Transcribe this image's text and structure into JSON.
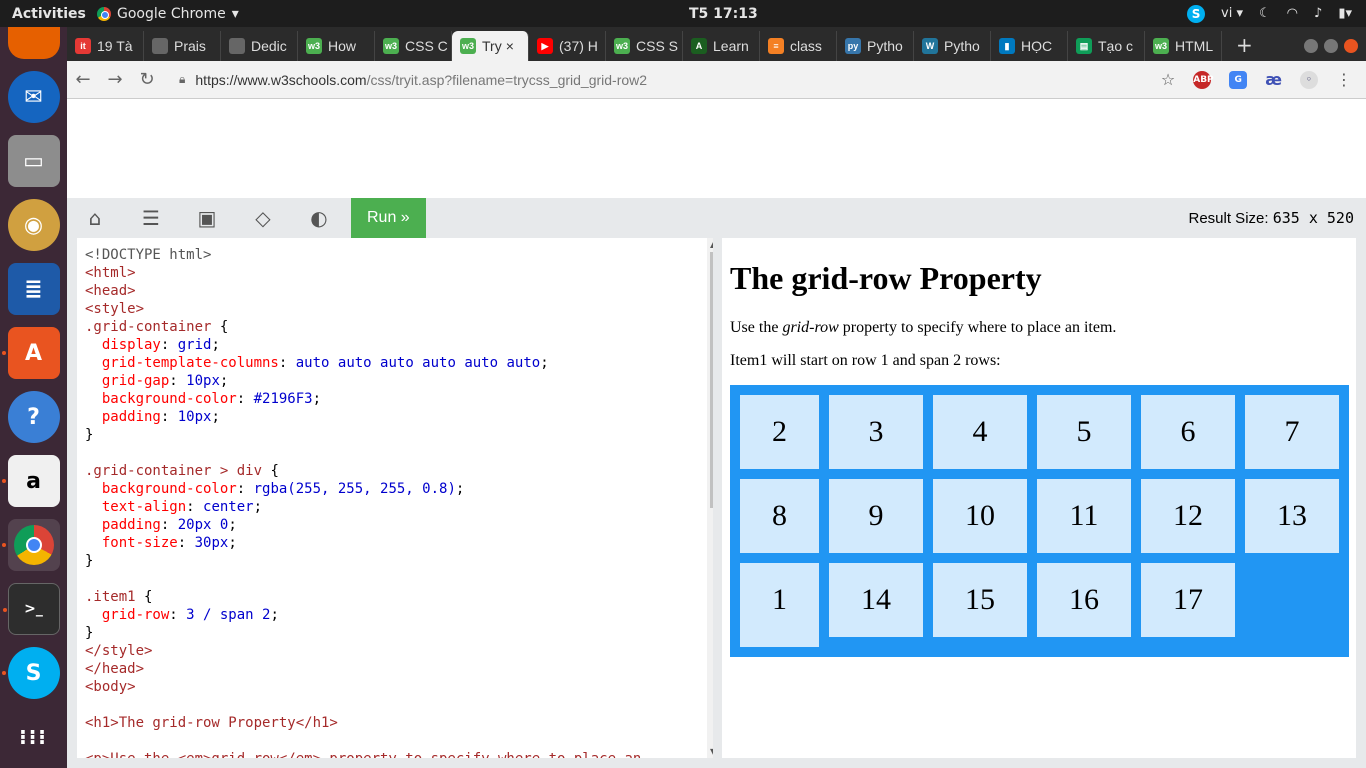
{
  "system": {
    "activities": "Activities",
    "app_name": "Google Chrome",
    "clock": "T5 17:13",
    "lang": "vi"
  },
  "tabs": [
    {
      "title": "19 Tà",
      "color": "#e53935",
      "icon_text": "it"
    },
    {
      "title": "Prais",
      "color": "#666666",
      "icon_text": ""
    },
    {
      "title": "Dedic",
      "color": "#666666",
      "icon_text": ""
    },
    {
      "title": "How",
      "color": "#4caf50",
      "icon_text": "w3"
    },
    {
      "title": "CSS C",
      "color": "#4caf50",
      "icon_text": "w3"
    },
    {
      "title": "Try",
      "color": "#4caf50",
      "icon_text": "w3",
      "active": true
    },
    {
      "title": "(37) H",
      "color": "#ff0000",
      "icon_text": "▶"
    },
    {
      "title": "CSS S",
      "color": "#4caf50",
      "icon_text": "w3"
    },
    {
      "title": "Learn",
      "color": "#1b5e20",
      "icon_text": "A"
    },
    {
      "title": "class",
      "color": "#f48024",
      "icon_text": "≡"
    },
    {
      "title": "Pytho",
      "color": "#3776ab",
      "icon_text": "py"
    },
    {
      "title": "Pytho",
      "color": "#21759b",
      "icon_text": "W"
    },
    {
      "title": "HỌC",
      "color": "#0079bf",
      "icon_text": "▮"
    },
    {
      "title": "Tạo c",
      "color": "#0f9d58",
      "icon_text": "▤"
    },
    {
      "title": "HTML",
      "color": "#4caf50",
      "icon_text": "w3"
    }
  ],
  "address": {
    "url_host": "https://www.w3schools.com",
    "url_path": "/css/tryit.asp?filename=trycss_grid_grid-row2"
  },
  "w3": {
    "run_label": "Run »",
    "result_size_label": "Result Size:",
    "result_size_value": "635  x  520"
  },
  "result": {
    "heading": "The grid-row Property",
    "intro_before": "Use the ",
    "intro_em": "grid-row",
    "intro_after": " property to specify where to place an item.",
    "note": "Item1 will start on row 1 and span 2 rows:",
    "grid_items": [
      "2",
      "3",
      "4",
      "5",
      "6",
      "7",
      "8",
      "9",
      "10",
      "11",
      "12",
      "13",
      "1",
      "14",
      "15",
      "16",
      "17"
    ]
  },
  "code_lines": [
    "<!DOCTYPE html>",
    "<html>",
    "<head>",
    "<style>",
    ".grid-container {",
    "  display: grid;",
    "  grid-template-columns: auto auto auto auto auto auto;",
    "  grid-gap: 10px;",
    "  background-color: #2196F3;",
    "  padding: 10px;",
    "}",
    "",
    ".grid-container > div {",
    "  background-color: rgba(255, 255, 255, 0.8);",
    "  text-align: center;",
    "  padding: 20px 0;",
    "  font-size: 30px;",
    "}",
    "",
    ".item1 {",
    "  grid-row: 3 / span 2;",
    "}",
    "</style>",
    "</head>",
    "<body>",
    "",
    "<h1>The grid-row Property</h1>",
    "",
    "<p>Use the <em>grid-row</em> property to specify where to place an"
  ]
}
